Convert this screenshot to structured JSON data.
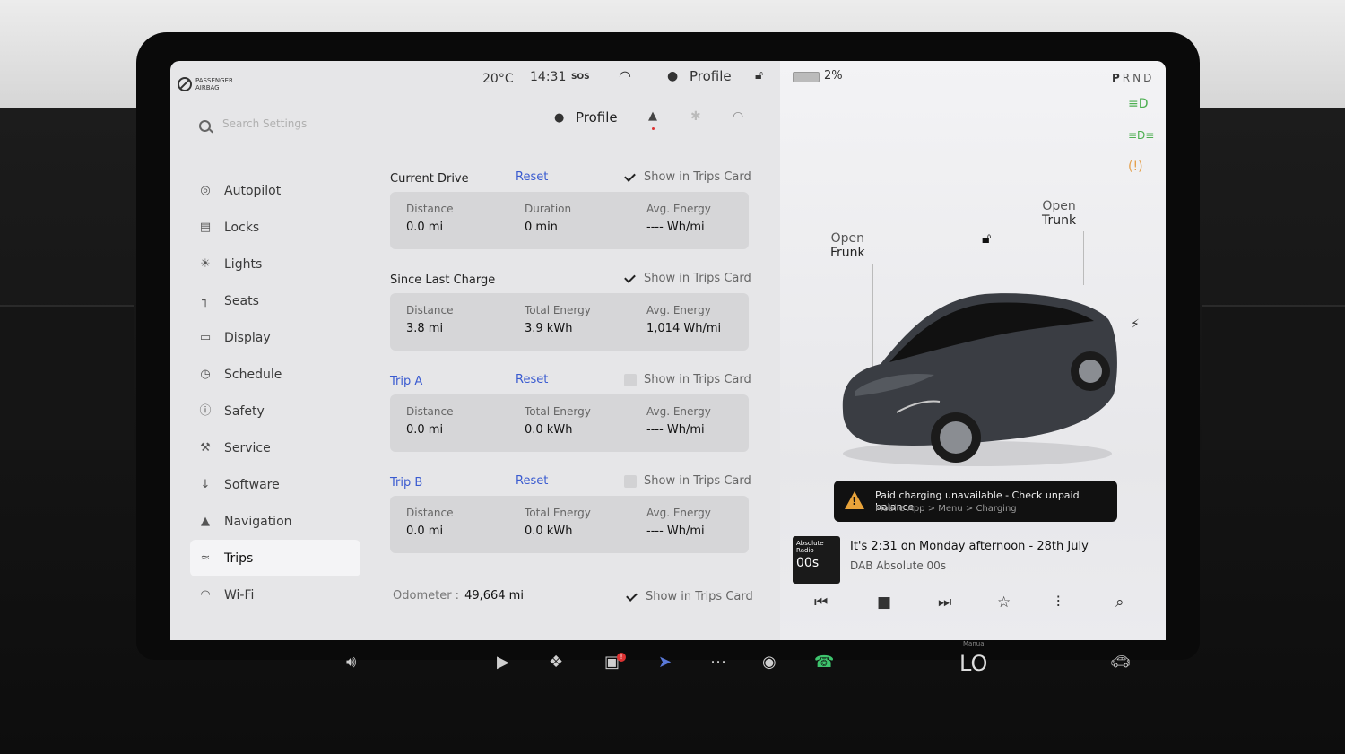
{
  "statusbar": {
    "airbag_line1": "PASSENGER",
    "airbag_line2": "AIRBAG",
    "temperature": "20°C",
    "time": "14:31",
    "sos": "SOS",
    "profile": "Profile",
    "battery": "2%",
    "battery_level": 0.02,
    "gear": [
      "P",
      "R",
      "N",
      "D"
    ]
  },
  "settings": {
    "search_placeholder": "Search Settings",
    "profile": "Profile",
    "nav": [
      {
        "label": "Autopilot",
        "icon": "steering-wheel-icon"
      },
      {
        "label": "Locks",
        "icon": "lock-icon"
      },
      {
        "label": "Lights",
        "icon": "sun-icon"
      },
      {
        "label": "Seats",
        "icon": "seat-icon"
      },
      {
        "label": "Display",
        "icon": "display-icon"
      },
      {
        "label": "Schedule",
        "icon": "clock-icon"
      },
      {
        "label": "Safety",
        "icon": "info-icon"
      },
      {
        "label": "Service",
        "icon": "wrench-icon"
      },
      {
        "label": "Software",
        "icon": "download-icon"
      },
      {
        "label": "Navigation",
        "icon": "navigation-icon"
      },
      {
        "label": "Trips",
        "icon": "trips-icon",
        "active": true
      },
      {
        "label": "Wi-Fi",
        "icon": "wifi-icon"
      }
    ]
  },
  "trips": {
    "reset_label": "Reset",
    "show_label": "Show in Trips Card",
    "sections": [
      {
        "title": "Current Drive",
        "link_style": false,
        "show": true,
        "cols": [
          {
            "label": "Distance",
            "value": "0.0  mi"
          },
          {
            "label": "Duration",
            "value": "0  min"
          },
          {
            "label": "Avg. Energy",
            "value": "----  Wh/mi"
          }
        ]
      },
      {
        "title": "Since Last Charge",
        "link_style": false,
        "show": true,
        "cols": [
          {
            "label": "Distance",
            "value": "3.8  mi"
          },
          {
            "label": "Total Energy",
            "value": "3.9  kWh"
          },
          {
            "label": "Avg. Energy",
            "value": "1,014  Wh/mi"
          }
        ]
      },
      {
        "title": "Trip A",
        "link_style": true,
        "show": false,
        "cols": [
          {
            "label": "Distance",
            "value": "0.0  mi"
          },
          {
            "label": "Total Energy",
            "value": "0.0  kWh"
          },
          {
            "label": "Avg. Energy",
            "value": "----  Wh/mi"
          }
        ]
      },
      {
        "title": "Trip B",
        "link_style": true,
        "show": false,
        "cols": [
          {
            "label": "Distance",
            "value": "0.0  mi"
          },
          {
            "label": "Total Energy",
            "value": "0.0  kWh"
          },
          {
            "label": "Avg. Energy",
            "value": "----  Wh/mi"
          }
        ]
      }
    ],
    "odometer_label": "Odometer :",
    "odometer_value": "49,664  mi"
  },
  "car": {
    "frunk_line1": "Open",
    "frunk_line2": "Frunk",
    "trunk_line1": "Open",
    "trunk_line2": "Trunk"
  },
  "alert": {
    "title": "Paid charging unavailable - Check unpaid balance",
    "subtitle": "Mobile App > Menu > Charging"
  },
  "media": {
    "cover_line1": "Absolute",
    "cover_line2": "Radio",
    "cover_big": "00s",
    "title": "It's 2:31 on Monday afternoon - 28th July",
    "station": "DAB Absolute 00s"
  },
  "taskbar": {
    "climate_mode": "Manual",
    "climate_temp": "LO",
    "camera_badge": "!"
  },
  "colors": {
    "accent_link": "#3a5bd0",
    "alert_icon": "#e8a33a",
    "battery_low": "#dd3333"
  }
}
